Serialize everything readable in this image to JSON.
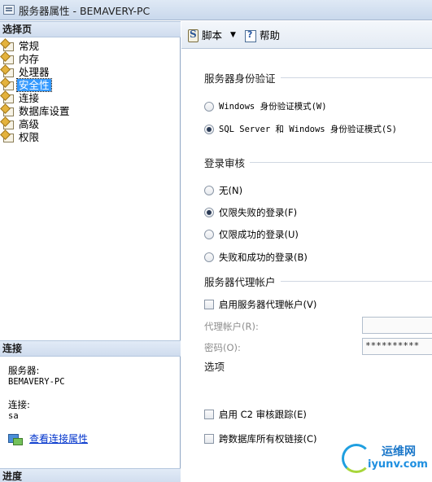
{
  "window": {
    "title": "服务器属性 - BEMAVERY-PC"
  },
  "left": {
    "select_page_header": "选择页",
    "nav": [
      {
        "label": "常规",
        "selected": false
      },
      {
        "label": "内存",
        "selected": false
      },
      {
        "label": "处理器",
        "selected": false
      },
      {
        "label": "安全性",
        "selected": true
      },
      {
        "label": "连接",
        "selected": false
      },
      {
        "label": "数据库设置",
        "selected": false
      },
      {
        "label": "高级",
        "selected": false
      },
      {
        "label": "权限",
        "selected": false
      }
    ],
    "connection_header": "连接",
    "server_label": "服务器:",
    "server_value": "BEMAVERY-PC",
    "connection_label": "连接:",
    "connection_value": "sa",
    "view_link": "查看连接属性",
    "progress_header": "进度"
  },
  "toolbar": {
    "script_label": "脚本",
    "help_label": "帮助"
  },
  "auth": {
    "title": "服务器身份验证",
    "windows_mode": "Windows 身份验证模式(W)",
    "mixed_mode": "SQL Server 和 Windows 身份验证模式(S)"
  },
  "audit": {
    "title": "登录审核",
    "none": "无(N)",
    "failed_only": "仅限失败的登录(F)",
    "success_only": "仅限成功的登录(U)",
    "both": "失败和成功的登录(B)"
  },
  "proxy": {
    "title": "服务器代理帐户",
    "enable": "启用服务器代理帐户(V)",
    "account_label": "代理帐户(R):",
    "account_value": "",
    "password_label": "密码(O):",
    "password_value": "**********"
  },
  "options": {
    "title": "选项",
    "c2_trace": "启用 C2 审核跟踪(E)",
    "cross_db": "跨数据库所有权链接(C)"
  },
  "watermark": {
    "name": "运维网",
    "url": "iyunv.com"
  }
}
